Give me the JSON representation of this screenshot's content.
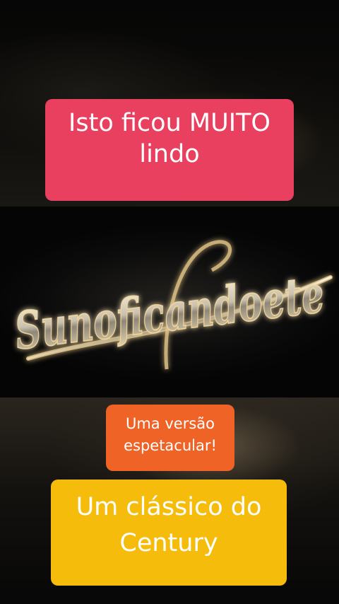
{
  "caption_top": [
    "Isto ficou MUITO",
    "lindo"
  ],
  "logo_text": "Sunoficandoete",
  "caption_middle": [
    "Uma versão",
    "espetacular!"
  ],
  "caption_bottom": [
    "Um clássico do",
    "Century"
  ],
  "colors": {
    "caption_top_bg": "#e8405e",
    "caption_middle_bg": "#ef6326",
    "caption_bottom_bg": "#f5bc0b",
    "logo_gold": "#e8c98a"
  }
}
